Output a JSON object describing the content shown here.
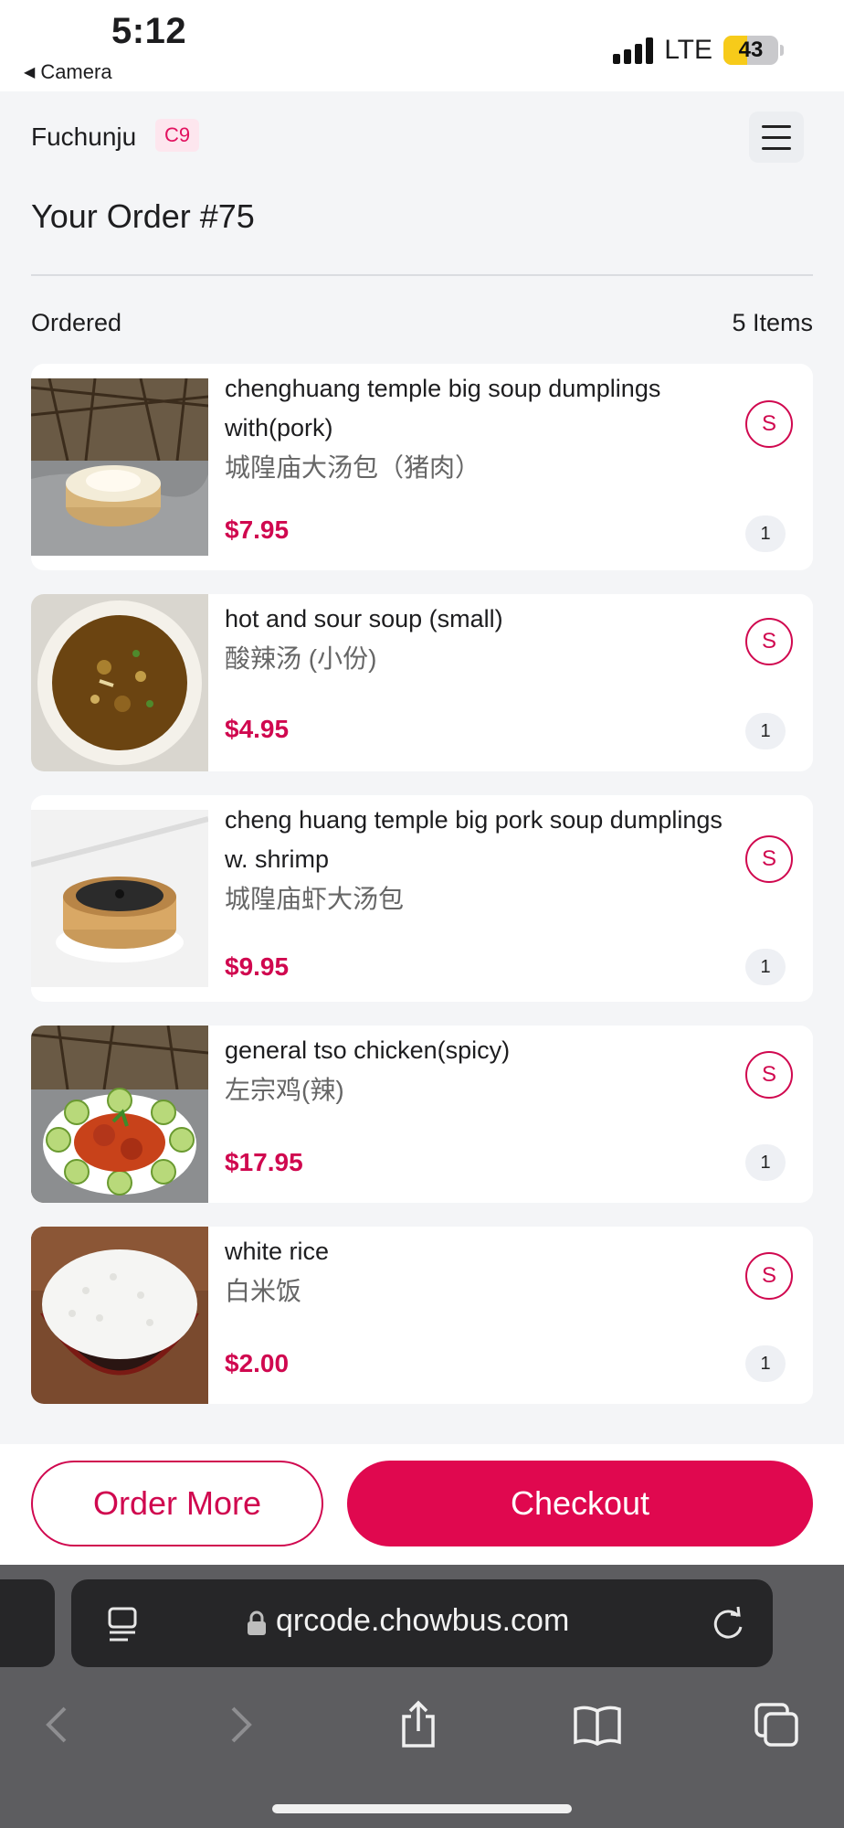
{
  "status_bar": {
    "time": "5:12",
    "back_label": "Camera",
    "network": "LTE",
    "battery": "43",
    "battery_level": 0.43
  },
  "header": {
    "restaurant_name": "Fuchunju",
    "table_code": "C9",
    "order_title": "Your Order #75"
  },
  "section": {
    "label": "Ordered",
    "count": "5 Items"
  },
  "items": [
    {
      "name": "chenghuang temple big soup dumplings with(pork)",
      "name_cn": "城隍庙大汤包（猪肉）",
      "price": "$7.95",
      "tag": "S",
      "qty": "1",
      "image": "soup-dumpling-bamboo-steamer"
    },
    {
      "name": "hot and sour soup (small)",
      "name_cn": "酸辣汤 (小份)",
      "price": "$4.95",
      "tag": "S",
      "qty": "1",
      "image": "hot-and-sour-soup-bowl"
    },
    {
      "name": "cheng huang temple big pork soup dumplings w. shrimp",
      "name_cn": "城隍庙虾大汤包",
      "price": "$9.95",
      "tag": "S",
      "qty": "1",
      "image": "black-soup-dumpling-steamer"
    },
    {
      "name": "general tso chicken(spicy)",
      "name_cn": "左宗鸡(辣)",
      "price": "$17.95",
      "tag": "S",
      "qty": "1",
      "image": "general-tso-chicken-plate"
    },
    {
      "name": "white rice",
      "name_cn": "白米饭",
      "price": "$2.00",
      "tag": "S",
      "qty": "1",
      "image": "white-rice-bowl"
    }
  ],
  "actions": {
    "order_more": "Order More",
    "checkout": "Checkout"
  },
  "browser": {
    "url": "qrcode.chowbus.com"
  },
  "colors": {
    "accent": "#e0084f",
    "price": "#d0084f",
    "badge_bg": "#fde6ee",
    "battery": "#f7cb1a"
  }
}
